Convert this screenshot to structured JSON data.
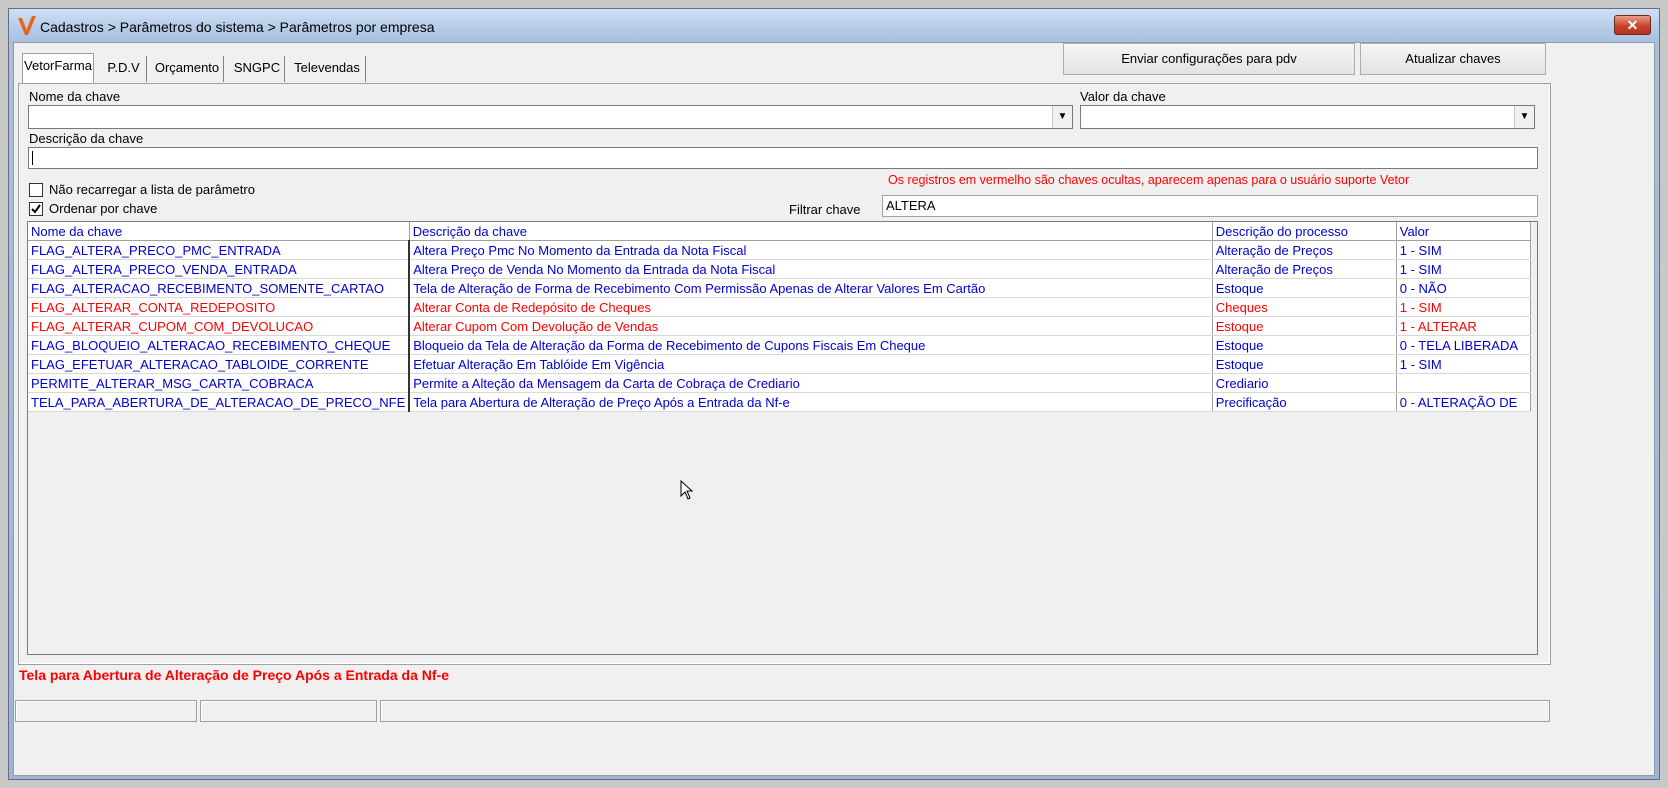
{
  "window": {
    "title": "Cadastros > Parâmetros do sistema > Parâmetros por empresa",
    "close_label": "✕",
    "app_icon": "v-logo-icon"
  },
  "tabs": [
    {
      "label": "VetorFarma",
      "active": true
    },
    {
      "label": "P.D.V",
      "active": false
    },
    {
      "label": "Orçamento",
      "active": false
    },
    {
      "label": "SNGPC",
      "active": false
    },
    {
      "label": "Televendas",
      "active": false
    }
  ],
  "toolbar": {
    "send_label": "Enviar configurações para  pdv",
    "update_label": "Atualizar chaves"
  },
  "filters": {
    "key_name_label": "Nome da chave",
    "key_name_value": "",
    "key_value_label": "Valor da chave",
    "key_value_value": "",
    "key_desc_label": "Descrição da chave",
    "key_desc_value": "",
    "no_reload_label": "Não recarregar a lista de parâmetro",
    "no_reload_checked": false,
    "order_label": "Ordenar por chave",
    "order_checked": true,
    "hidden_note": "Os registros em vermelho são chaves ocultas, aparecem apenas para o usuário suporte Vetor",
    "filter_label": "Filtrar chave",
    "filter_value": "ALTERA"
  },
  "grid": {
    "columns": [
      "Nome da chave",
      "Descrição  da chave",
      "Descrição do processo",
      "Valor"
    ],
    "rows": [
      {
        "key": "FLAG_ALTERA_PRECO_PMC_ENTRADA",
        "desc": "Altera Preço Pmc No Momento da Entrada da Nota Fiscal",
        "process": "Alteração de Preços",
        "value": "1 - SIM",
        "hidden": false
      },
      {
        "key": "FLAG_ALTERA_PRECO_VENDA_ENTRADA",
        "desc": "Altera Preço de Venda No Momento da Entrada da Nota Fiscal",
        "process": "Alteração de Preços",
        "value": "1 - SIM",
        "hidden": false
      },
      {
        "key": "FLAG_ALTERACAO_RECEBIMENTO_SOMENTE_CARTAO",
        "desc": "Tela de Alteração de Forma de Recebimento Com Permissão Apenas de Alterar Valores Em Cartão",
        "process": "Estoque",
        "value": "0 - NÃO",
        "hidden": false
      },
      {
        "key": "FLAG_ALTERAR_CONTA_REDEPOSITO",
        "desc": "Alterar Conta de Redepósito de Cheques",
        "process": "Cheques",
        "value": "1 - SIM",
        "hidden": true
      },
      {
        "key": "FLAG_ALTERAR_CUPOM_COM_DEVOLUCAO",
        "desc": "Alterar Cupom Com Devolução de Vendas",
        "process": "Estoque",
        "value": "1 - ALTERAR",
        "hidden": true
      },
      {
        "key": "FLAG_BLOQUEIO_ALTERACAO_RECEBIMENTO_CHEQUE",
        "desc": "Bloqueio da Tela de Alteração da Forma de Recebimento de Cupons Fiscais Em Cheque",
        "process": "Estoque",
        "value": "0 - TELA LIBERADA",
        "hidden": false
      },
      {
        "key": "FLAG_EFETUAR_ALTERACAO_TABLOIDE_CORRENTE",
        "desc": "Efetuar Alteração Em Tablóide Em Vigência",
        "process": "Estoque",
        "value": "1 - SIM",
        "hidden": false
      },
      {
        "key": "PERMITE_ALTERAR_MSG_CARTA_COBRACA",
        "desc": "Permite a Alteção da Mensagem da Carta de Cobraça de Crediario",
        "process": "Crediario",
        "value": "",
        "hidden": false
      },
      {
        "key": "TELA_PARA_ABERTURA_DE_ALTERACAO_DE_PRECO_NFE",
        "desc": "Tela para Abertura de Alteração de Preço Após a Entrada da Nf-e",
        "process": "Precificação",
        "value": "0 - ALTERAÇÃO DE",
        "hidden": false
      }
    ]
  },
  "selected_description": "Tela para Abertura de Alteração de Preço Após a Entrada da Nf-e",
  "colors": {
    "normal_row": "#0000cc",
    "hidden_row": "#ff0000"
  }
}
